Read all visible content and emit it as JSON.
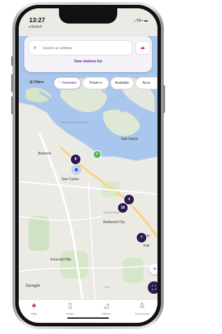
{
  "status": {
    "time": "13:27",
    "back_label": "◂ Search",
    "right": "⋅ᵢₗ 5G+ ▬"
  },
  "search": {
    "placeholder": "Search an address",
    "car_label": "🚗",
    "view_list": "View stations list"
  },
  "filters": [
    {
      "label": "Filters",
      "icon": "sliders-icon"
    },
    {
      "label": "♡ Favorites"
    },
    {
      "label": "Power ▾"
    },
    {
      "label": "Available"
    },
    {
      "label": "Acce"
    }
  ],
  "map_labels": {
    "belmont": "Belmont",
    "san_carlos": "San Carlos",
    "bair_island": "Bair Island",
    "redwood_city": "Redwood City",
    "emerald_hills": "Emerald Hills",
    "google": "Google",
    "redwood_shores": "REDWOOD SHORES",
    "centennial": "CENTENNIAL",
    "fair": "Fair",
    "tin": "Tin",
    "ple": "PLE"
  },
  "clusters": [
    "8",
    "4",
    "18",
    "7"
  ],
  "green_pin": "⚡",
  "tabs": [
    {
      "label": "Map",
      "icon": "♣",
      "active": true
    },
    {
      "label": "Home",
      "icon": "▯",
      "active": false
    },
    {
      "label": "History",
      "icon": "◿",
      "active": false
    },
    {
      "label": "My Account",
      "icon": "♙",
      "active": false
    }
  ]
}
